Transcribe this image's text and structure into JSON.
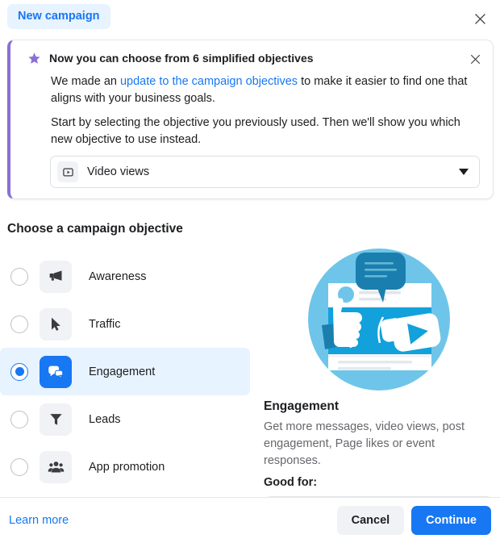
{
  "header": {
    "breadcrumb_label": "New campaign",
    "close_icon": "close-icon"
  },
  "banner": {
    "star_icon": "star-icon",
    "title": "Now you can choose from 6 simplified objectives",
    "close_icon": "close-icon",
    "paragraph1_prefix": "We made an ",
    "paragraph1_link": "update to the campaign objectives",
    "paragraph1_suffix": " to make it easier to find one that aligns with your business goals.",
    "paragraph2": "Start by selecting the objective you previously used. Then we'll show you which new objective to use instead.",
    "select": {
      "icon": "video-play-icon",
      "value": "Video views",
      "caret_icon": "chevron-down-icon",
      "options": [
        "Video views"
      ]
    }
  },
  "main": {
    "section_title": "Choose a campaign objective",
    "objectives": [
      {
        "label": "Awareness",
        "icon": "megaphone-icon",
        "selected": false
      },
      {
        "label": "Traffic",
        "icon": "cursor-arrow-icon",
        "selected": false
      },
      {
        "label": "Engagement",
        "icon": "chat-bubbles-icon",
        "selected": true
      },
      {
        "label": "Leads",
        "icon": "funnel-icon",
        "selected": false
      },
      {
        "label": "App promotion",
        "icon": "people-group-icon",
        "selected": false
      },
      {
        "label": "",
        "icon": "sales-icon",
        "selected": false
      }
    ]
  },
  "detail": {
    "illustration": "engagement-illustration",
    "title": "Engagement",
    "description": "Get more messages, video views, post engagement, Page likes or event responses.",
    "good_for_label": "Good for:"
  },
  "footer": {
    "learn_more_label": "Learn more",
    "cancel_label": "Cancel",
    "continue_label": "Continue"
  },
  "colors": {
    "accent_blue": "#1877f2",
    "pill_bg": "#e7f3ff",
    "banner_accent": "#8b70d4",
    "tile_gray": "#f0f2f5",
    "text_muted": "#65676b"
  }
}
